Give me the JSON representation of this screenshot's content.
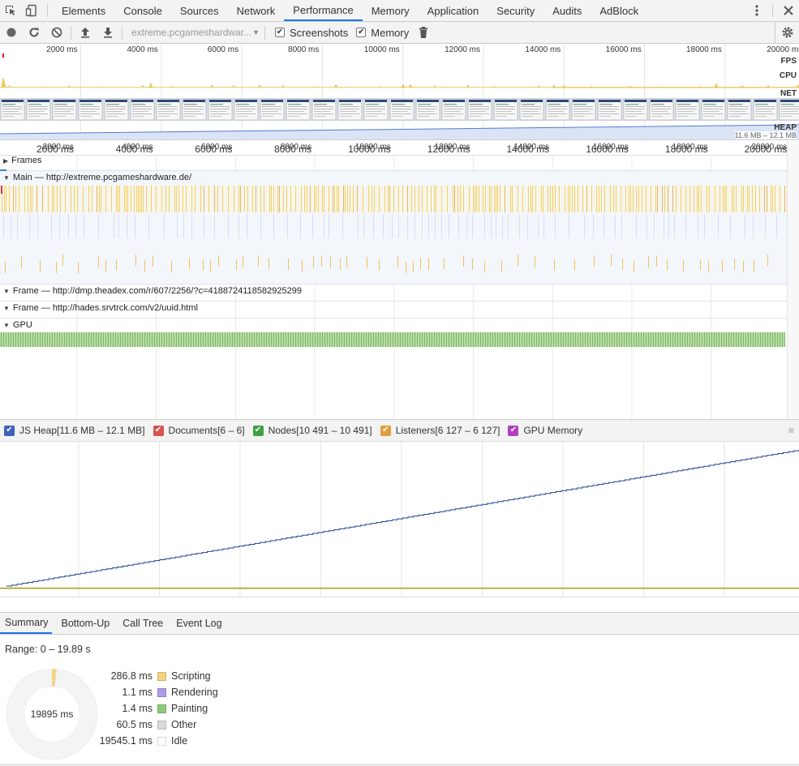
{
  "tabs": [
    {
      "label": "Elements",
      "active": false
    },
    {
      "label": "Console",
      "active": false
    },
    {
      "label": "Sources",
      "active": false
    },
    {
      "label": "Network",
      "active": false
    },
    {
      "label": "Performance",
      "active": true
    },
    {
      "label": "Memory",
      "active": false
    },
    {
      "label": "Application",
      "active": false
    },
    {
      "label": "Security",
      "active": false
    },
    {
      "label": "Audits",
      "active": false
    },
    {
      "label": "AdBlock",
      "active": false
    }
  ],
  "toolbar": {
    "url_select": "extreme.pcgameshardwar...",
    "screenshots_label": "Screenshots",
    "screenshots_checked": true,
    "memory_label": "Memory",
    "memory_checked": true
  },
  "overview": {
    "labels": {
      "fps": "FPS",
      "cpu": "CPU",
      "net": "NET",
      "heap": "HEAP"
    },
    "heap_range": "11.6 MB – 12.1 MB",
    "time_ticks": [
      "2000 ms",
      "4000 ms",
      "6000 ms",
      "8000 ms",
      "10000 ms",
      "12000 ms",
      "14000 ms",
      "16000 ms",
      "18000 ms",
      "20000 ms"
    ]
  },
  "flamechart": {
    "time_ticks": [
      "2000 ms",
      "4000 ms",
      "6000 ms",
      "8000 ms",
      "10000 ms",
      "12000 ms",
      "14000 ms",
      "16000 ms",
      "18000 ms",
      "20000 ms"
    ],
    "tracks": {
      "frames": "Frames",
      "main": "Main — http://extreme.pcgameshardware.de/",
      "frame1": "Frame — http://dmp.theadex.com/r/607/2256/?c=4188724118582925299",
      "frame2": "Frame — http://hades.srvtrck.com/v2/uuid.html",
      "gpu": "GPU"
    }
  },
  "counters": [
    {
      "label": "JS Heap[11.6 MB – 12.1 MB]",
      "color": "#3d63b8"
    },
    {
      "label": "Documents[6 – 6]",
      "color": "#d9534f"
    },
    {
      "label": "Nodes[10 491 – 10 491]",
      "color": "#43a047"
    },
    {
      "label": "Listeners[6 127 – 6 127]",
      "color": "#e0a040"
    },
    {
      "label": "GPU Memory",
      "color": "#b040c0"
    }
  ],
  "bottom_tabs": [
    {
      "label": "Summary",
      "active": true
    },
    {
      "label": "Bottom-Up",
      "active": false
    },
    {
      "label": "Call Tree",
      "active": false
    },
    {
      "label": "Event Log",
      "active": false
    }
  ],
  "summary": {
    "range": "Range: 0 – 19.89 s",
    "total": "19895 ms",
    "items": [
      {
        "value": "286.8 ms",
        "name": "Scripting",
        "color": "#f2d47f",
        "ms": 286.8
      },
      {
        "value": "1.1 ms",
        "name": "Rendering",
        "color": "#af9be6",
        "ms": 1.1
      },
      {
        "value": "1.4 ms",
        "name": "Painting",
        "color": "#8dc97a",
        "ms": 1.4
      },
      {
        "value": "60.5 ms",
        "name": "Other",
        "color": "#dadada",
        "ms": 60.5
      },
      {
        "value": "19545.1 ms",
        "name": "Idle",
        "color": "#ffffff",
        "ms": 19545.1
      }
    ]
  }
}
